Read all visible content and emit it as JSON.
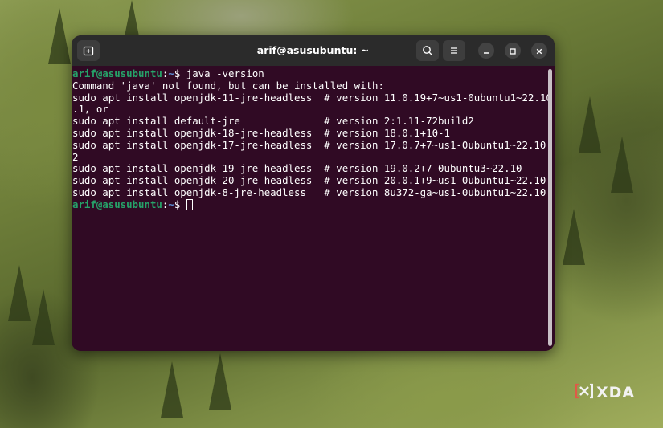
{
  "window": {
    "title": "arif@asusubuntu: ~"
  },
  "terminal": {
    "prompt_user": "arif@asusubuntu",
    "prompt_path": "~",
    "prompt_symbol": "$ ",
    "command": "java -version",
    "output_lines": [
      "Command 'java' not found, but can be installed with:",
      "sudo apt install openjdk-11-jre-headless  # version 11.0.19+7~us1-0ubuntu1~22.10",
      ".1, or",
      "sudo apt install default-jre              # version 2:1.11-72build2",
      "sudo apt install openjdk-18-jre-headless  # version 18.0.1+10-1",
      "sudo apt install openjdk-17-jre-headless  # version 17.0.7+7~us1-0ubuntu1~22.10.",
      "2",
      "sudo apt install openjdk-19-jre-headless  # version 19.0.2+7-0ubuntu3~22.10",
      "sudo apt install openjdk-20-jre-headless  # version 20.0.1+9~us1-0ubuntu1~22.10",
      "sudo apt install openjdk-8-jre-headless   # version 8u372-ga~us1-0ubuntu1~22.10"
    ]
  },
  "watermark": {
    "brand": "XDA"
  },
  "icons": {
    "new_tab": "new-tab-icon",
    "search": "search-icon",
    "menu": "hamburger-menu-icon",
    "minimize": "minimize-icon",
    "maximize": "maximize-icon",
    "close": "close-icon",
    "brand_logo": "xda-logo-icon"
  },
  "colors": {
    "terminal_bg": "#300a24",
    "titlebar_bg": "#2b2b2b",
    "prompt_user": "#26a269",
    "prompt_path": "#5b8fd8",
    "text": "#ffffff"
  }
}
